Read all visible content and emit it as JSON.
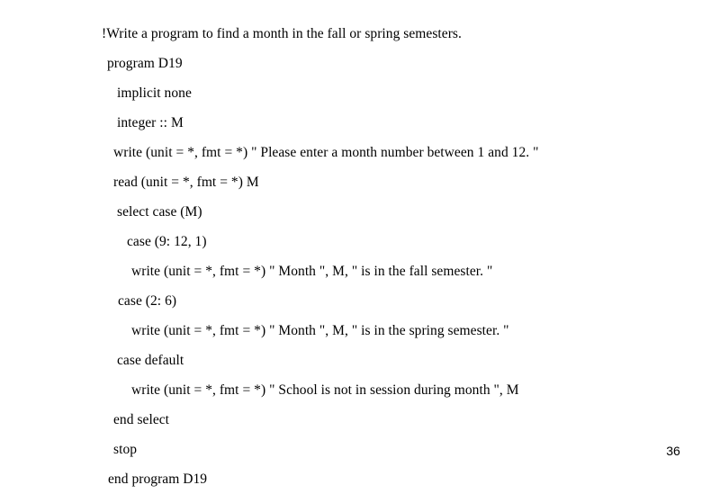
{
  "slide": {
    "page_number": "36",
    "background_color": "#ffffff",
    "text_color": "#000000",
    "code_lines": [
      {
        "text": "!Write a program to find a month in the fall or spring semesters.",
        "indent": 0
      },
      {
        "text": "program D19",
        "indent": 1
      },
      {
        "text": "implicit none",
        "indent": 2
      },
      {
        "text": "integer :: M",
        "indent": 2
      },
      {
        "text": "write (unit = *, fmt = *) \" Please enter a month number between 1 and 12. \"",
        "indent": 3
      },
      {
        "text": "read (unit = *, fmt = *) M",
        "indent": 3
      },
      {
        "text": "select case (M)",
        "indent": 2
      },
      {
        "text": "case (9: 12, 1)",
        "indent": 4
      },
      {
        "text": "write (unit = *, fmt = *) \" Month \", M, \" is in the fall semester. \"",
        "indent": 5
      },
      {
        "text": "case (2: 6)",
        "indent": 6
      },
      {
        "text": "write (unit = *, fmt = *) \" Month \", M, \" is in the spring semester. \"",
        "indent": 5
      },
      {
        "text": "case default",
        "indent": 7
      },
      {
        "text": "write (unit = *, fmt = *) \" School is not in session during month \", M",
        "indent": 5
      },
      {
        "text": "end select",
        "indent": 3
      },
      {
        "text": "stop",
        "indent": 3
      },
      {
        "text": "end program D19",
        "indent": 8
      }
    ]
  }
}
